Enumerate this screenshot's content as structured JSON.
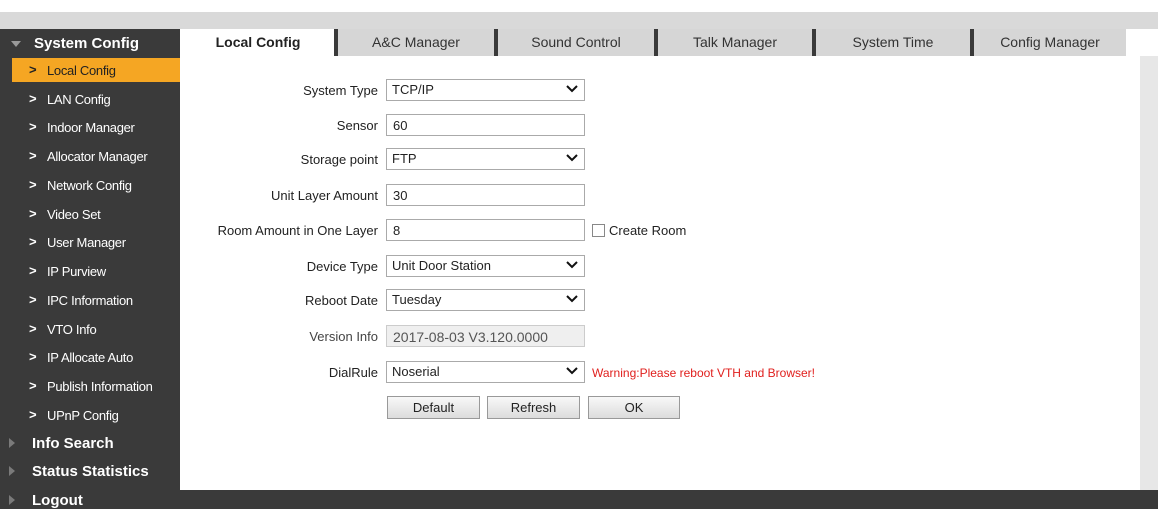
{
  "sidebar": {
    "system_config": "System Config",
    "items": [
      {
        "label": "Local Config"
      },
      {
        "label": "LAN Config"
      },
      {
        "label": "Indoor Manager"
      },
      {
        "label": "Allocator Manager"
      },
      {
        "label": "Network Config"
      },
      {
        "label": "Video Set"
      },
      {
        "label": "User Manager"
      },
      {
        "label": "IP Purview"
      },
      {
        "label": "IPC Information"
      },
      {
        "label": "VTO Info"
      },
      {
        "label": "IP Allocate Auto"
      },
      {
        "label": "Publish Information"
      },
      {
        "label": "UPnP Config"
      }
    ],
    "info_search": "Info Search",
    "status_statistics": "Status Statistics",
    "logout": "Logout",
    "chevron": ">"
  },
  "tabs": [
    {
      "label": "Local Config"
    },
    {
      "label": "A&C Manager"
    },
    {
      "label": "Sound Control"
    },
    {
      "label": "Talk Manager"
    },
    {
      "label": "System Time"
    },
    {
      "label": "Config Manager"
    }
  ],
  "form": {
    "system_type": {
      "label": "System Type",
      "value": "TCP/IP"
    },
    "sensor": {
      "label": "Sensor",
      "value": "60"
    },
    "storage_point": {
      "label": "Storage point",
      "value": "FTP"
    },
    "unit_layer_amount": {
      "label": "Unit Layer Amount",
      "value": "30"
    },
    "room_amount": {
      "label": "Room Amount in One Layer",
      "value": "8",
      "checkbox_label": "Create Room"
    },
    "device_type": {
      "label": "Device Type",
      "value": "Unit Door Station"
    },
    "reboot_date": {
      "label": "Reboot Date",
      "value": "Tuesday"
    },
    "version_info": {
      "label": "Version Info",
      "value": "2017-08-03 V3.120.0000"
    },
    "dial_rule": {
      "label": "DialRule",
      "value": "Noserial",
      "warning": "Warning:Please reboot VTH and Browser!"
    }
  },
  "buttons": {
    "default": "Default",
    "refresh": "Refresh",
    "ok": "OK"
  },
  "colors": {
    "sidebar_bg": "#3a3a3a",
    "active_item": "#f5a623",
    "warning": "#e0201e"
  }
}
